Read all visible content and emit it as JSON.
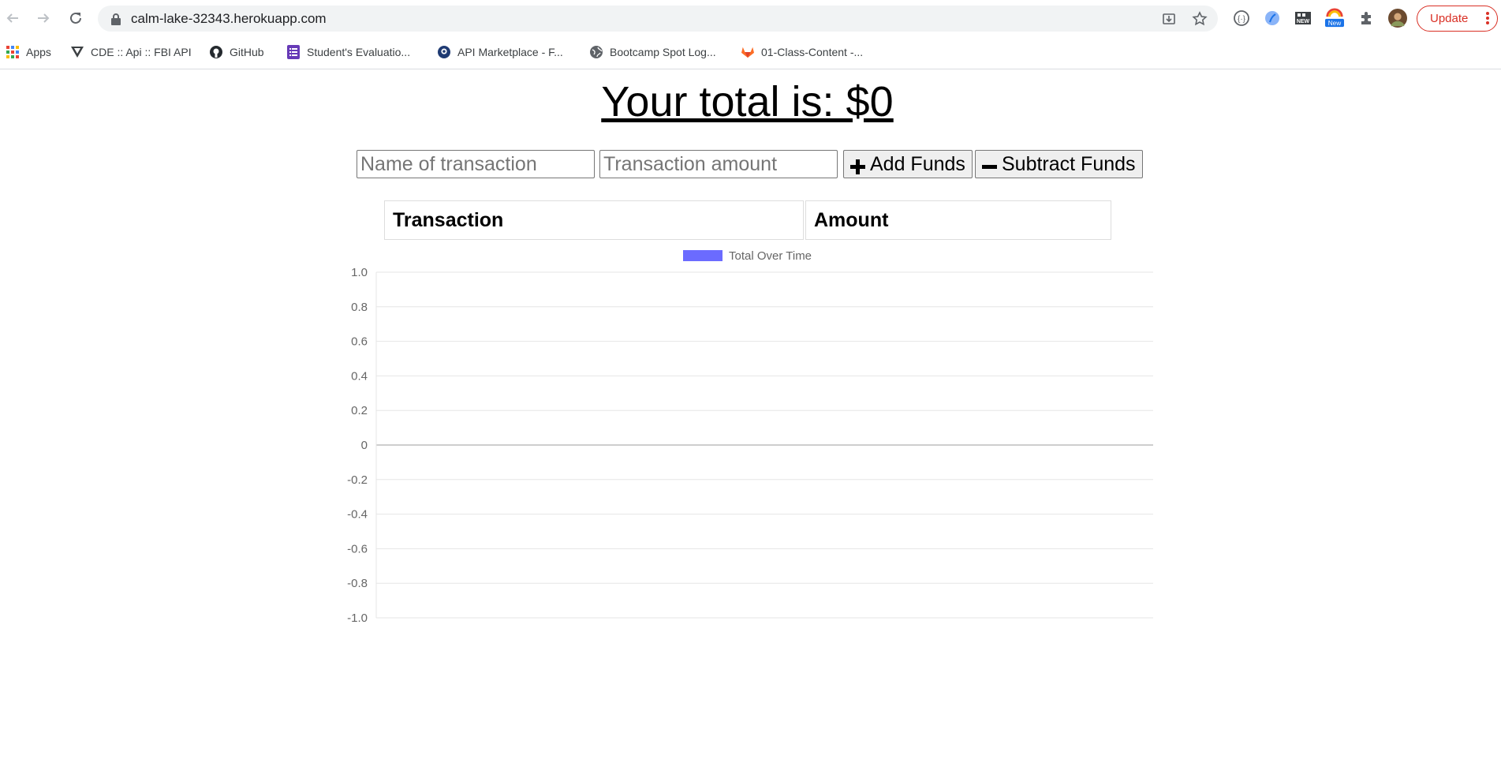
{
  "browser": {
    "url": "calm-lake-32343.herokuapp.com",
    "update_label": "Update",
    "extension_badge": "New",
    "extension_badge2": "NEW",
    "bookmarks": [
      {
        "label": "Apps",
        "icon": "apps-grid-icon"
      },
      {
        "label": "CDE :: Api :: FBI API",
        "icon": "fbi-icon"
      },
      {
        "label": "GitHub",
        "icon": "github-icon"
      },
      {
        "label": "Student's Evaluatio...",
        "icon": "form-icon"
      },
      {
        "label": "API Marketplace - F...",
        "icon": "rapidapi-icon"
      },
      {
        "label": "Bootcamp Spot Log...",
        "icon": "globe-icon"
      },
      {
        "label": "01-Class-Content -...",
        "icon": "gitlab-icon"
      }
    ]
  },
  "page": {
    "total_prefix": "Your total is: $",
    "total_value": "0",
    "name_placeholder": "Name of transaction",
    "amount_placeholder": "Transaction amount",
    "add_label": "Add Funds",
    "subtract_label": "Subtract Funds",
    "table_headers": [
      "Transaction",
      "Amount"
    ]
  },
  "colors": {
    "legend_fill": "#6b6bff",
    "update_red": "#d93025",
    "grid": "#e6e6e6"
  },
  "chart_data": {
    "type": "line",
    "series": [
      {
        "name": "Total Over Time",
        "values": []
      }
    ],
    "x": [],
    "ylim": [
      -1.0,
      1.0
    ],
    "yticks": [
      "1.0",
      "0.8",
      "0.6",
      "0.4",
      "0.2",
      "0",
      "-0.2",
      "-0.4",
      "-0.6",
      "-0.8",
      "-1.0"
    ],
    "grid": true,
    "legend": "top"
  }
}
